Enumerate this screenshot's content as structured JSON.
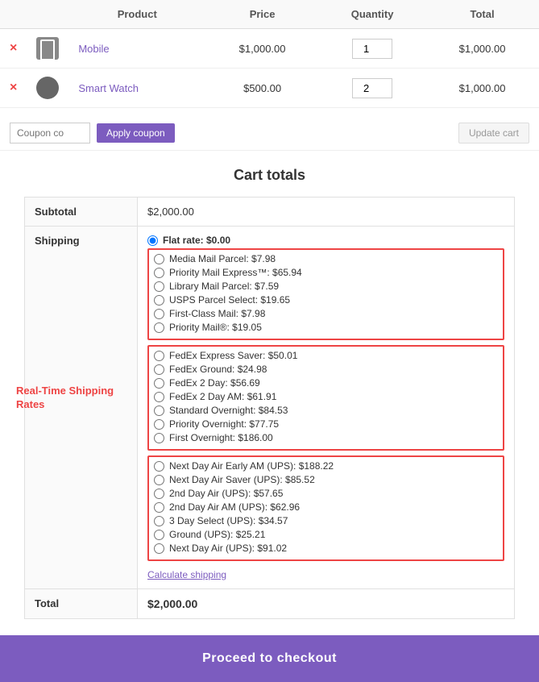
{
  "table": {
    "headers": [
      "",
      "Product",
      "Price",
      "Quantity",
      "Total"
    ],
    "rows": [
      {
        "id": "row-mobile",
        "remove": "×",
        "product_icon": "mobile",
        "product_name": "Mobile",
        "price": "$1,000.00",
        "quantity": "1",
        "total": "$1,000.00"
      },
      {
        "id": "row-watch",
        "remove": "×",
        "product_icon": "watch",
        "product_name": "Smart Watch",
        "price": "$500.00",
        "quantity": "2",
        "total": "$1,000.00"
      }
    ]
  },
  "coupon": {
    "placeholder": "Coupon co",
    "apply_label": "Apply coupon",
    "update_label": "Update cart"
  },
  "cart_totals": {
    "title": "Cart totals",
    "subtotal_label": "Subtotal",
    "subtotal_value": "$2,000.00",
    "shipping_label": "Shipping",
    "flat_rate_label": "Flat rate: $0.00",
    "shipping_groups": [
      {
        "options": [
          "Media Mail Parcel: $7.98",
          "Priority Mail Express™: $65.94",
          "Library Mail Parcel: $7.59",
          "USPS Parcel Select: $19.65",
          "First-Class Mail: $7.98",
          "Priority Mail®: $19.05"
        ]
      },
      {
        "options": [
          "FedEx Express Saver: $50.01",
          "FedEx Ground: $24.98",
          "FedEx 2 Day: $56.69",
          "FedEx 2 Day AM: $61.91",
          "Standard Overnight: $84.53",
          "Priority Overnight: $77.75",
          "First Overnight: $186.00"
        ]
      },
      {
        "options": [
          "Next Day Air Early AM (UPS): $188.22",
          "Next Day Air Saver (UPS): $85.52",
          "2nd Day Air (UPS): $57.65",
          "2nd Day Air AM (UPS): $62.96",
          "3 Day Select (UPS): $34.57",
          "Ground (UPS): $25.21",
          "Next Day Air (UPS): $91.02"
        ]
      }
    ],
    "calculate_shipping_label": "Calculate shipping",
    "total_label": "Total",
    "total_value": "$2,000.00",
    "realtime_label": "Real-Time Shipping Rates",
    "checkout_label": "Proceed to checkout"
  }
}
